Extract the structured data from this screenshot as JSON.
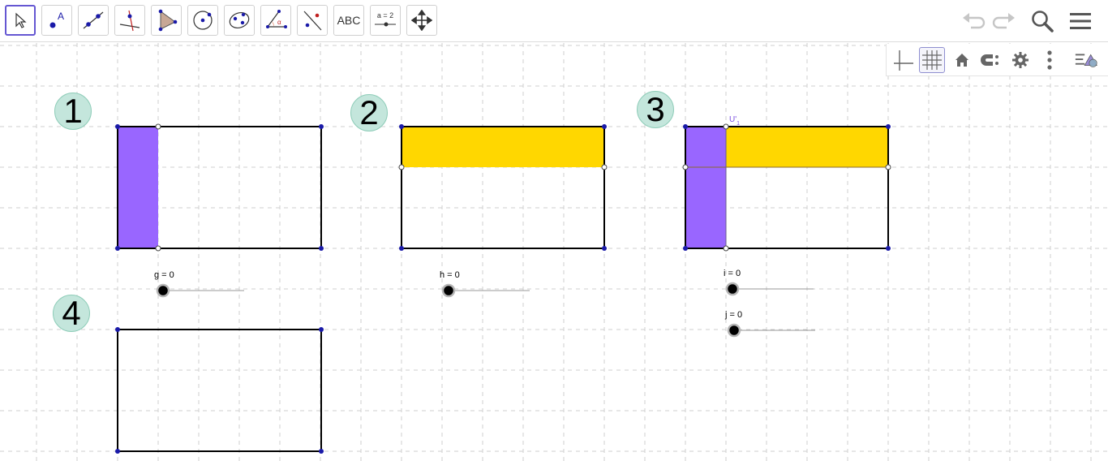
{
  "toolbar": {
    "tools": [
      {
        "name": "move-tool",
        "label": "",
        "selected": true
      },
      {
        "name": "point-tool",
        "label": "A"
      },
      {
        "name": "line-tool",
        "label": ""
      },
      {
        "name": "perpendicular-line-tool",
        "label": ""
      },
      {
        "name": "polygon-tool",
        "label": ""
      },
      {
        "name": "circle-tool",
        "label": ""
      },
      {
        "name": "conic-tool",
        "label": ""
      },
      {
        "name": "angle-tool",
        "label": ""
      },
      {
        "name": "reflect-tool",
        "label": ""
      },
      {
        "name": "text-tool",
        "label": "ABC"
      },
      {
        "name": "slider-tool",
        "label": "a = 2"
      },
      {
        "name": "move-graphics-tool",
        "label": ""
      }
    ],
    "undo_icon": "undo-icon",
    "redo_icon": "redo-icon",
    "search_icon": "search-icon",
    "menu_icon": "hamburger-menu-icon"
  },
  "stylebar": {
    "buttons": [
      "axes-toggle-icon",
      "grid-toggle-icon",
      "home-icon",
      "point-capture-icon",
      "settings-gear-icon",
      "more-vertical-icon",
      "view-menu-icon"
    ],
    "active": "grid-toggle-icon"
  },
  "figures": {
    "badges": [
      "1",
      "2",
      "3",
      "4"
    ],
    "sliders": [
      {
        "label": "g = 0"
      },
      {
        "label": "h = 0"
      },
      {
        "label": "i = 0"
      },
      {
        "label": "j = 0"
      }
    ],
    "point_label": "U'",
    "point_label_sub": "1"
  },
  "colors": {
    "purple": "#9966ff",
    "yellow": "#ffd700",
    "badge_fill": "#c4e6dc",
    "point": "#1a1aa8",
    "selected_tool": "#6557d2"
  }
}
